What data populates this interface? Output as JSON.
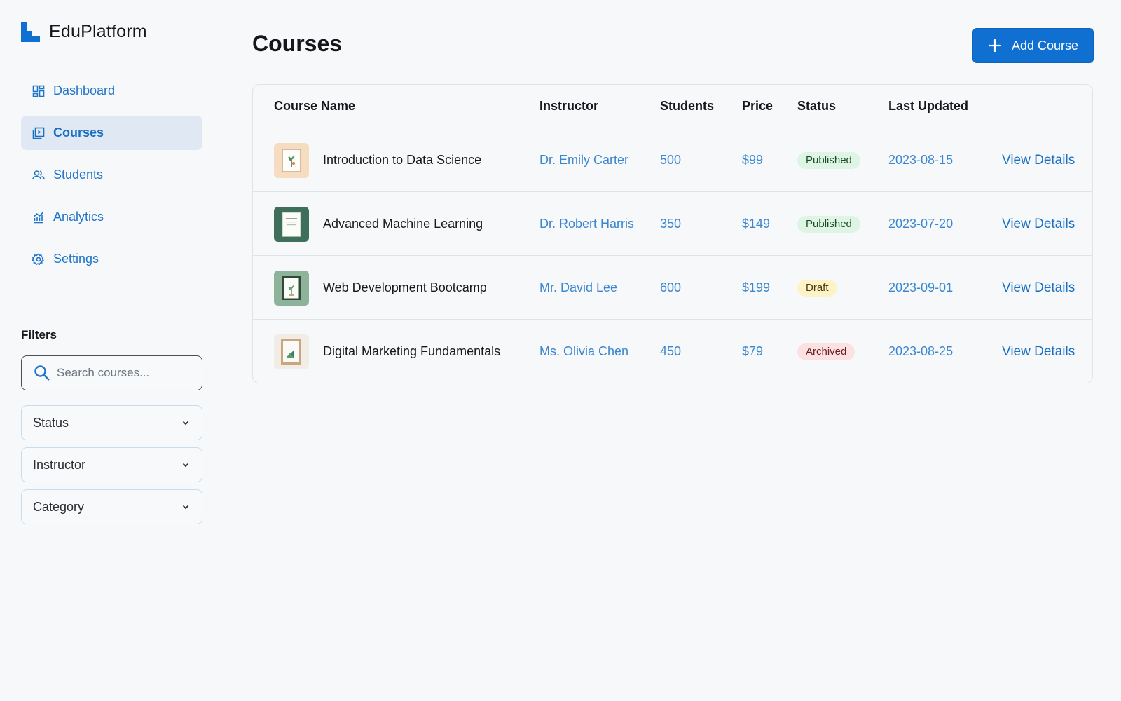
{
  "brand": {
    "name": "EduPlatform"
  },
  "nav": {
    "items": [
      {
        "label": "Dashboard",
        "icon": "dashboard-icon"
      },
      {
        "label": "Courses",
        "icon": "courses-icon",
        "active": true
      },
      {
        "label": "Students",
        "icon": "students-icon"
      },
      {
        "label": "Analytics",
        "icon": "analytics-icon"
      },
      {
        "label": "Settings",
        "icon": "settings-icon"
      }
    ]
  },
  "filters": {
    "title": "Filters",
    "search_placeholder": "Search courses...",
    "selects": [
      "Status",
      "Instructor",
      "Category"
    ]
  },
  "header": {
    "title": "Courses",
    "add_button": "Add Course"
  },
  "table": {
    "columns": [
      "Course Name",
      "Instructor",
      "Students",
      "Price",
      "Status",
      "Last Updated"
    ],
    "rows": [
      {
        "name": "Introduction to Data Science",
        "instructor": "Dr. Emily Carter",
        "students": "500",
        "price": "$99",
        "status": "Published",
        "updated": "2023-08-15",
        "action": "View Details"
      },
      {
        "name": "Advanced Machine Learning",
        "instructor": "Dr. Robert Harris",
        "students": "350",
        "price": "$149",
        "status": "Published",
        "updated": "2023-07-20",
        "action": "View Details"
      },
      {
        "name": "Web Development Bootcamp",
        "instructor": "Mr. David Lee",
        "students": "600",
        "price": "$199",
        "status": "Draft",
        "updated": "2023-09-01",
        "action": "View Details"
      },
      {
        "name": "Digital Marketing Fundamentals",
        "instructor": "Ms. Olivia Chen",
        "students": "450",
        "price": "$79",
        "status": "Archived",
        "updated": "2023-08-25",
        "action": "View Details"
      }
    ]
  },
  "colors": {
    "accent": "#1070d2",
    "nav_text": "#1f74c9",
    "nav_active_bg": "#e0e9f3",
    "published_bg": "#def5e4",
    "draft_bg": "#fdf3c6",
    "archived_bg": "#fbe1e1"
  }
}
